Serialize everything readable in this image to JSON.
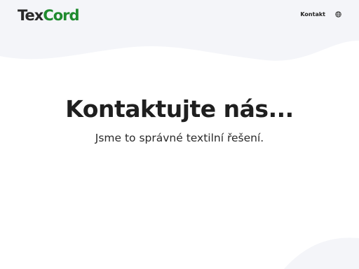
{
  "header": {
    "logo_part1": "Tex",
    "logo_part2": "Cord",
    "nav": {
      "contact_label": "Kontakt"
    }
  },
  "hero": {
    "title": "Kontaktujte nás...",
    "subtitle": "Jsme to správné textilní řešení."
  },
  "colors": {
    "logo_dark": "#2a2a2a",
    "logo_green": "#1f8a2e",
    "background_wave": "#f3f4f8"
  },
  "icons": {
    "language": "globe-icon"
  }
}
